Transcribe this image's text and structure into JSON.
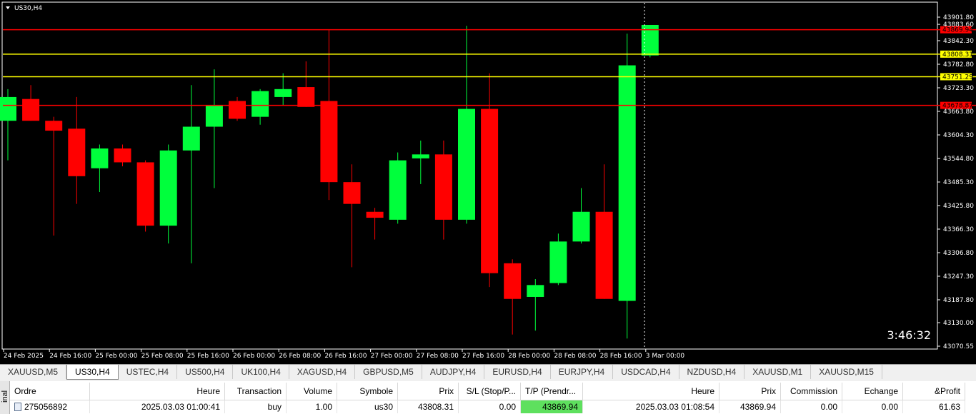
{
  "chart": {
    "title": "US30,H4",
    "timer": "3:46:32",
    "price_axis_labels": [
      "43901.80",
      "43883.60",
      "43842.30",
      "43782.80",
      "43723.30",
      "43663.80",
      "43604.30",
      "43544.80",
      "43485.30",
      "43425.80",
      "43366.30",
      "43306.80",
      "43247.30",
      "43187.80",
      "43130.00",
      "43070.55"
    ],
    "time_axis_labels": [
      "24 Feb 2025",
      "24 Feb 16:00",
      "25 Feb 00:00",
      "25 Feb 08:00",
      "25 Feb 16:00",
      "26 Feb 00:00",
      "26 Feb 08:00",
      "26 Feb 16:00",
      "27 Feb 00:00",
      "27 Feb 08:00",
      "27 Feb 16:00",
      "28 Feb 00:00",
      "28 Feb 08:00",
      "28 Feb 16:00",
      "3 Mar 00:00"
    ],
    "levels": [
      {
        "label": "43869.94",
        "color": "#ff0000",
        "value": 43869.94
      },
      {
        "label": "43808.31",
        "color": "#ffff00",
        "value": 43808.31
      },
      {
        "label": "43751.29",
        "color": "#ffff00",
        "value": 43751.29
      },
      {
        "label": "43678.87",
        "color": "#ff0000",
        "value": 43678.87
      }
    ],
    "colors": {
      "bull": "#00ff3c",
      "bear": "#ff0000",
      "bg": "#000000",
      "axis": "#ffffff"
    }
  },
  "chart_data": {
    "type": "candlestick",
    "title": "US30,H4",
    "ylim": [
      43070.55,
      43901.8
    ],
    "candles": [
      {
        "o": 43640,
        "h": 43720,
        "l": 43540,
        "c": 43700
      },
      {
        "o": 43695,
        "h": 43730,
        "l": 43640,
        "c": 43640
      },
      {
        "o": 43640,
        "h": 43650,
        "l": 43350,
        "c": 43615
      },
      {
        "o": 43620,
        "h": 43700,
        "l": 43430,
        "c": 43500
      },
      {
        "o": 43520,
        "h": 43580,
        "l": 43460,
        "c": 43570
      },
      {
        "o": 43570,
        "h": 43580,
        "l": 43525,
        "c": 43535
      },
      {
        "o": 43535,
        "h": 43540,
        "l": 43360,
        "c": 43375
      },
      {
        "o": 43375,
        "h": 43580,
        "l": 43330,
        "c": 43565
      },
      {
        "o": 43565,
        "h": 43730,
        "l": 43280,
        "c": 43625
      },
      {
        "o": 43625,
        "h": 43770,
        "l": 43470,
        "c": 43680
      },
      {
        "o": 43690,
        "h": 43700,
        "l": 43640,
        "c": 43645
      },
      {
        "o": 43650,
        "h": 43720,
        "l": 43630,
        "c": 43715
      },
      {
        "o": 43700,
        "h": 43760,
        "l": 43680,
        "c": 43720
      },
      {
        "o": 43725,
        "h": 43790,
        "l": 43675,
        "c": 43675
      },
      {
        "o": 43690,
        "h": 43870,
        "l": 43440,
        "c": 43485
      },
      {
        "o": 43485,
        "h": 43530,
        "l": 43270,
        "c": 43430
      },
      {
        "o": 43410,
        "h": 43420,
        "l": 43340,
        "c": 43395
      },
      {
        "o": 43390,
        "h": 43560,
        "l": 43380,
        "c": 43540
      },
      {
        "o": 43545,
        "h": 43590,
        "l": 43480,
        "c": 43555
      },
      {
        "o": 43555,
        "h": 43590,
        "l": 43340,
        "c": 43390
      },
      {
        "o": 43390,
        "h": 43880,
        "l": 43380,
        "c": 43670
      },
      {
        "o": 43670,
        "h": 43760,
        "l": 43220,
        "c": 43255
      },
      {
        "o": 43280,
        "h": 43290,
        "l": 43100,
        "c": 43190
      },
      {
        "o": 43195,
        "h": 43240,
        "l": 43110,
        "c": 43225
      },
      {
        "o": 43230,
        "h": 43355,
        "l": 43225,
        "c": 43335
      },
      {
        "o": 43335,
        "h": 43470,
        "l": 43330,
        "c": 43410
      },
      {
        "o": 43410,
        "h": 43530,
        "l": 43190,
        "c": 43190
      },
      {
        "o": 43185,
        "h": 43860,
        "l": 43090,
        "c": 43780
      },
      {
        "o": 43805,
        "h": 43882,
        "l": 43800,
        "c": 43882
      }
    ]
  },
  "tabs": [
    {
      "label": "XAUUSD,M5",
      "active": false
    },
    {
      "label": "US30,H4",
      "active": true
    },
    {
      "label": "USTEC,H4",
      "active": false
    },
    {
      "label": "US500,H4",
      "active": false
    },
    {
      "label": "UK100,H4",
      "active": false
    },
    {
      "label": "XAGUSD,H4",
      "active": false
    },
    {
      "label": "GBPUSD,M5",
      "active": false
    },
    {
      "label": "AUDJPY,H4",
      "active": false
    },
    {
      "label": "EURUSD,H4",
      "active": false
    },
    {
      "label": "EURJPY,H4",
      "active": false
    },
    {
      "label": "USDCAD,H4",
      "active": false
    },
    {
      "label": "NZDUSD,H4",
      "active": false
    },
    {
      "label": "XAUUSD,M1",
      "active": false
    },
    {
      "label": "XAUUSD,M15",
      "active": false
    }
  ],
  "terminal": {
    "side_label": "inal",
    "columns": [
      "Ordre",
      "Heure",
      "Transaction",
      "Volume",
      "Symbole",
      "Prix",
      "S/L (Stop/P...",
      "T/P (Prendr...",
      "Heure",
      "Prix",
      "Commission",
      "Echange",
      "&Profit"
    ],
    "rows": [
      [
        "275056892",
        "2025.03.03 01:00:41",
        "buy",
        "1.00",
        "us30",
        "43808.31",
        "0.00",
        "43869.94",
        "2025.03.03 01:08:54",
        "43869.94",
        "0.00",
        "0.00",
        "61.63"
      ]
    ]
  }
}
